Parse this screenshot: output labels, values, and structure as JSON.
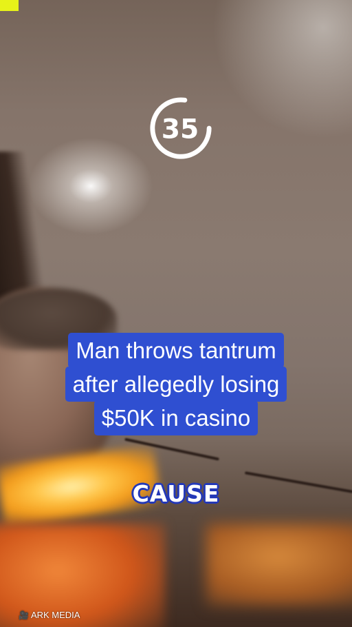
{
  "video": {
    "channel_logo_text": "35",
    "channel_logo_icon": "circular-35-logo",
    "headline_lines": [
      "Man throws tantrum",
      "after allegedly losing",
      "$50K in casino"
    ],
    "caption_word": "CAUSE",
    "watermark_icon": "camera-icon",
    "watermark_text": "ARK MEDIA"
  },
  "colors": {
    "headline_background": "#2f4fd1",
    "caption_outline": "#2338b8",
    "corner_badge": "#e7f219"
  }
}
